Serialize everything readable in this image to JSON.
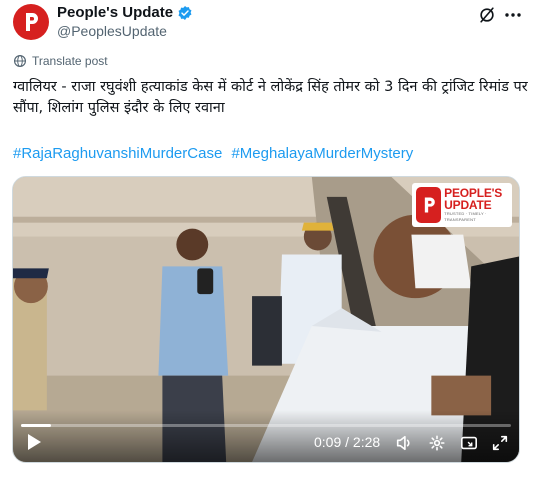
{
  "author": {
    "name": "People's Update",
    "handle": "@PeoplesUpdate",
    "avatar_icon": "peoples-update-logo",
    "verified_icon": "verified-badge-icon"
  },
  "header_icons": [
    "grok-icon",
    "more-icon"
  ],
  "translate_label": "Translate post",
  "text": "ग्वालियर - राजा रघुवंशी हत्याकांड केस में कोर्ट ने लोकेंद्र सिंह तोमर को 3 दिन की ट्रांजिट रिमांड पर सौंपा, शिलांग पुलिस इंदौर के लिए रवाना",
  "hashtags": [
    "#RajaRaghuvanshiMurderCase",
    "#MeghalayaMurderMystery"
  ],
  "video": {
    "watermark_line1": "PEOPLE'S",
    "watermark_line2": "UPDATE",
    "watermark_tagline": "TRUSTED · TIMELY · TRANSPARENT",
    "time": "0:09 / 2:28",
    "progress": 0.061,
    "control_icons": [
      "play-icon",
      "volume-icon",
      "settings-icon",
      "fullscreen-icon"
    ]
  },
  "colors": {
    "brand_red": "#d6201f",
    "link_blue": "#1d9bf0",
    "verified_blue": "#1d9bf0",
    "secondary_text": "#536471"
  }
}
